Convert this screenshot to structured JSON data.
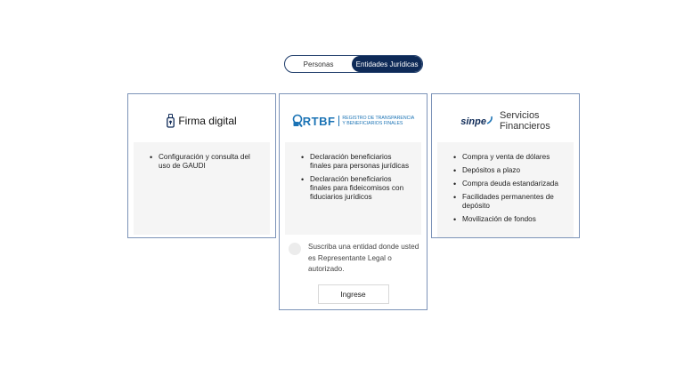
{
  "toggle": {
    "personas_label": "Personas",
    "entidades_label": "Entidades Jurídicas",
    "active": "Entidades Jurídicas"
  },
  "cards": {
    "firma": {
      "logo_text": "Firma digital",
      "items": [
        "Configuración y consulta del uso de GAUDI"
      ]
    },
    "rtbf": {
      "logo_mark": "RTBF",
      "logo_sub_1": "REGISTRO DE TRANSPARENCIA",
      "logo_sub_2": "Y BENEFICIARIOS FINALES",
      "items": [
        "Declaración beneficiarios finales para personas jurídicas",
        "Declaración beneficiarios finales para fideicomisos con fiduciarios jurídicos"
      ],
      "subscribe_text": "Suscriba una entidad donde usted es Representante Legal o autorizado.",
      "button_label": "Ingrese"
    },
    "sinpe": {
      "logo_mark": "sinpe",
      "logo_text_1": "Servicios",
      "logo_text_2": "Financieros",
      "items": [
        "Compra y venta de dólares",
        "Depósitos a plazo",
        "Compra deuda estandarizada",
        "Facilidades permanentes de depósito",
        "Movilización de fondos"
      ]
    }
  },
  "colors": {
    "primary": "#0e2a57",
    "card_border": "#7c93b8",
    "rtbf_blue": "#1b73b5"
  }
}
